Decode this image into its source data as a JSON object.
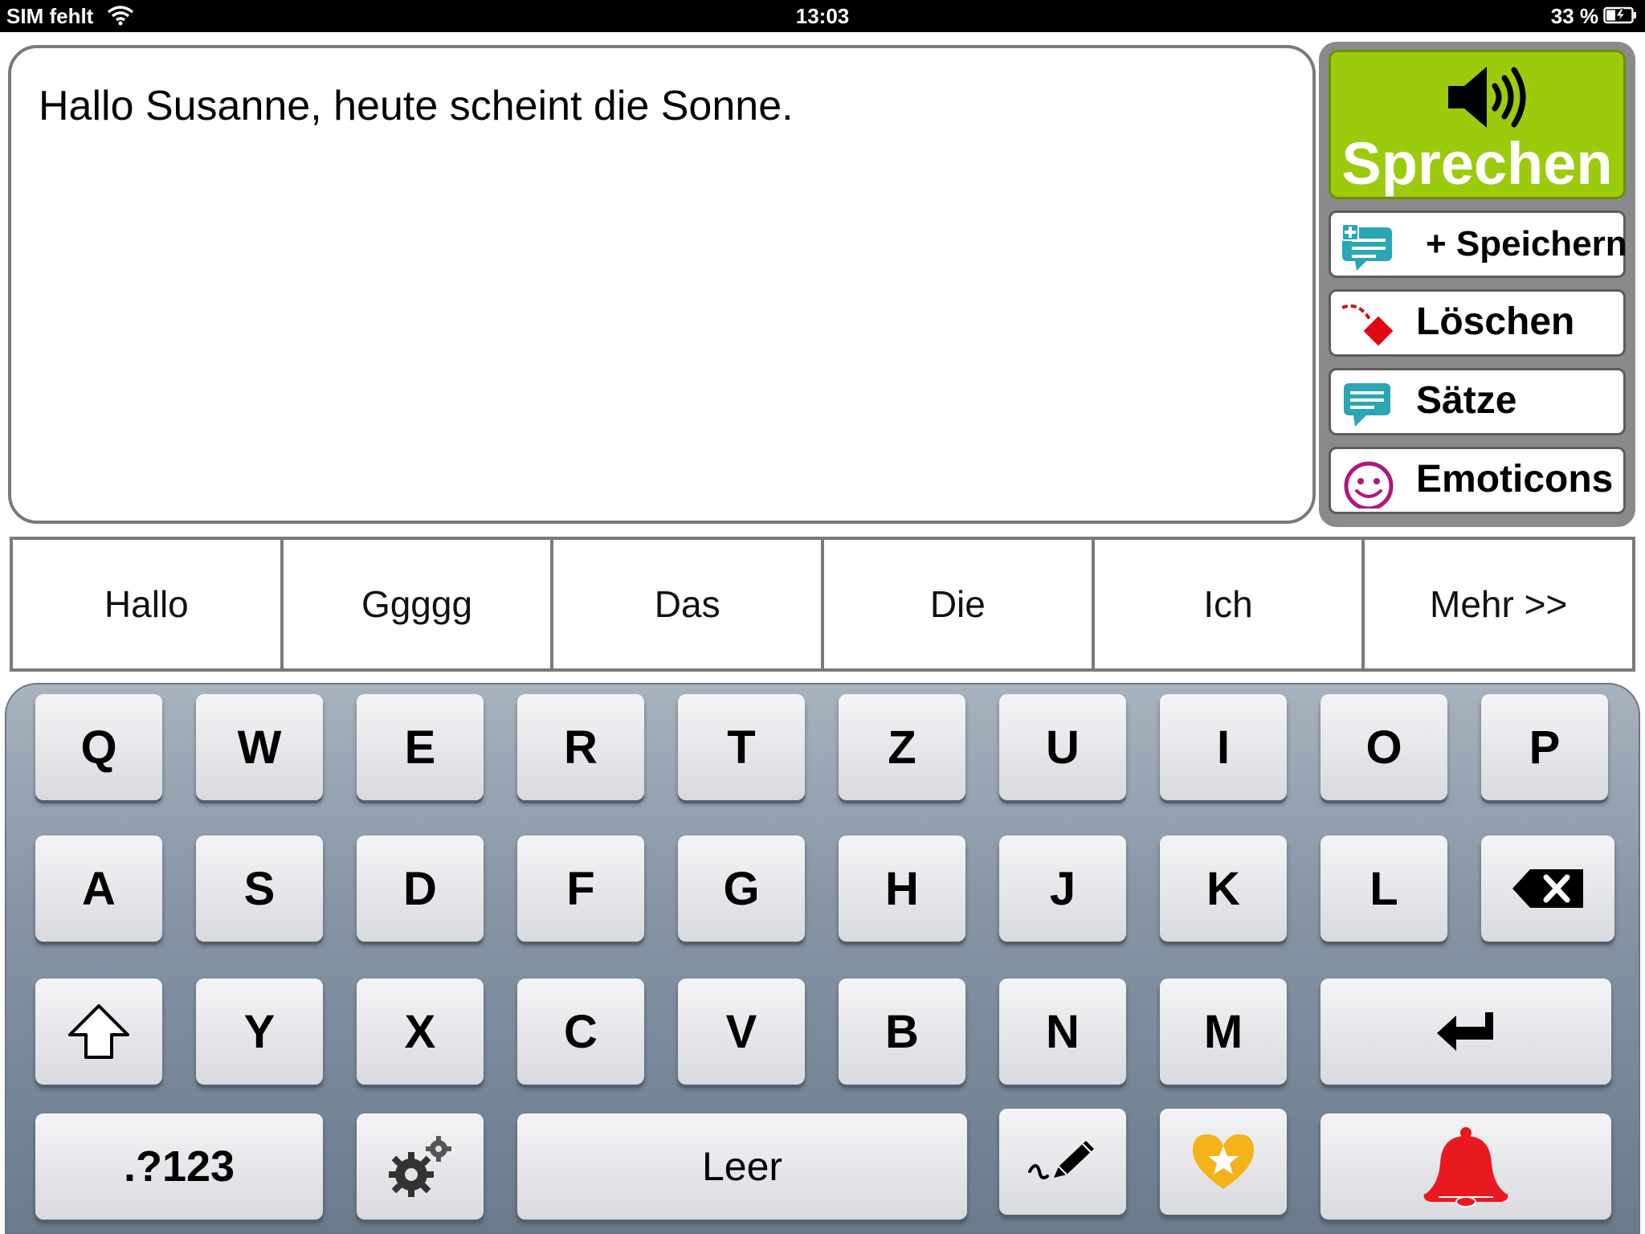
{
  "status_bar": {
    "carrier": "SIM fehlt",
    "time": "13:03",
    "battery": "33 %"
  },
  "text_area": {
    "content": "Hallo Susanne, heute scheint die Sonne."
  },
  "side_panel": {
    "speak_label": "Sprechen",
    "save_label": "+ Speichern",
    "delete_label": "Löschen",
    "sentences_label": "Sätze",
    "emoticons_label": "Emoticons"
  },
  "suggestions": [
    "Hallo",
    "Ggggg",
    "Das",
    "Die",
    "Ich",
    "Mehr >>"
  ],
  "keyboard": {
    "row1": [
      "Q",
      "W",
      "E",
      "R",
      "T",
      "Z",
      "U",
      "I",
      "O",
      "P"
    ],
    "row2": [
      "A",
      "S",
      "D",
      "F",
      "G",
      "H",
      "J",
      "K",
      "L"
    ],
    "row3": [
      "Y",
      "X",
      "C",
      "V",
      "B",
      "N",
      "M"
    ],
    "numbers_label": ".?123",
    "space_label": "Leer"
  },
  "colors": {
    "speak_button": "#9ccb0c",
    "keyboard_bg": "#8795a5",
    "bell": "#e8191f",
    "heart": "#f5b219"
  },
  "icons": {
    "speak": "speaker-icon",
    "save": "add-speech-bubble-icon",
    "delete": "eraser-icon",
    "sentences": "speech-bubble-icon",
    "emoticons": "smiley-icon",
    "backspace": "backspace-icon",
    "shift": "shift-arrow-icon",
    "enter": "return-arrow-icon",
    "settings": "gears-icon",
    "draw": "pen-icon",
    "favorites": "heart-star-icon",
    "alarm": "bell-icon"
  }
}
